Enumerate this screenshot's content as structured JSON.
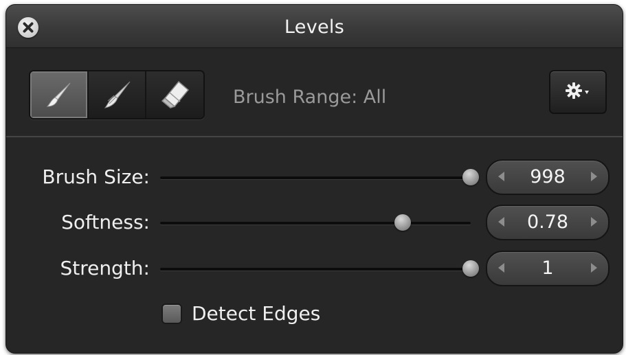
{
  "window": {
    "title": "Levels",
    "close_icon": "close-icon"
  },
  "toolbar": {
    "tools": [
      {
        "name": "brush",
        "icon": "brush-icon",
        "active": true
      },
      {
        "name": "feather",
        "icon": "feather-brush-icon",
        "active": false
      },
      {
        "name": "eraser",
        "icon": "eraser-icon",
        "active": false
      }
    ],
    "brush_range_label": "Brush Range: All",
    "actions_icon": "gear-icon"
  },
  "controls": {
    "brush_size": {
      "label": "Brush Size:",
      "value": "998",
      "slider_fraction": 1.0
    },
    "softness": {
      "label": "Softness:",
      "value": "0.78",
      "slider_fraction": 0.78
    },
    "strength": {
      "label": "Strength:",
      "value": "1",
      "slider_fraction": 1.0
    }
  },
  "detect_edges": {
    "label": "Detect Edges",
    "checked": false
  },
  "colors": {
    "panel_bg": "#262626",
    "title_text": "#f2f2f2",
    "secondary_text": "#9a9a9a"
  }
}
